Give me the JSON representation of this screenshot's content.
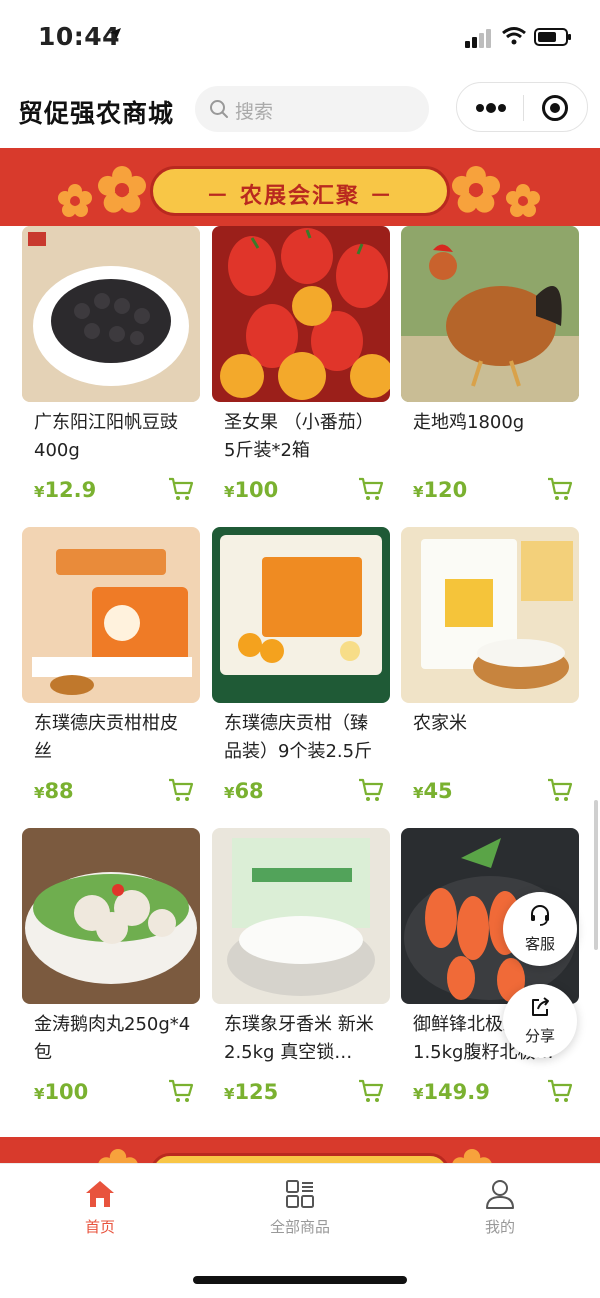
{
  "status_bar": {
    "time": "10:44"
  },
  "header": {
    "title": "贸促强农商城",
    "search_placeholder": "搜索"
  },
  "banner": {
    "text": "－ 农展会汇聚 －"
  },
  "products": [
    {
      "name": "广东阳江阳帆豆豉400g",
      "currency": "¥",
      "price": "12.9"
    },
    {
      "name": "圣女果 （小番茄）5斤装*2箱",
      "currency": "¥",
      "price": "100"
    },
    {
      "name": "走地鸡1800g",
      "currency": "¥",
      "price": "120"
    },
    {
      "name": "东璞德庆贡柑柑皮丝",
      "currency": "¥",
      "price": "88"
    },
    {
      "name": "东璞德庆贡柑（臻品装）9个装2.5斤",
      "currency": "¥",
      "price": "68"
    },
    {
      "name": "农家米",
      "currency": "¥",
      "price": "45"
    },
    {
      "name": "金涛鹅肉丸250g*4包",
      "currency": "¥",
      "price": "100"
    },
    {
      "name": "东璞象牙香米 新米2.5kg 真空锁…",
      "currency": "¥",
      "price": "125"
    },
    {
      "name": "御鲜锋北极虾 1.5kg腹籽北极…",
      "currency": "¥",
      "price": "149.9"
    }
  ],
  "float_buttons": {
    "service": "客服",
    "share": "分享"
  },
  "tabbar": {
    "items": [
      {
        "label": "首页",
        "icon": "home-icon",
        "active": true
      },
      {
        "label": "全部商品",
        "icon": "grid-icon",
        "active": false
      },
      {
        "label": "我的",
        "icon": "user-icon",
        "active": false
      }
    ]
  },
  "colors": {
    "accent_red": "#e8533d",
    "banner_red": "#d83a2c",
    "price_green": "#7ab130"
  }
}
